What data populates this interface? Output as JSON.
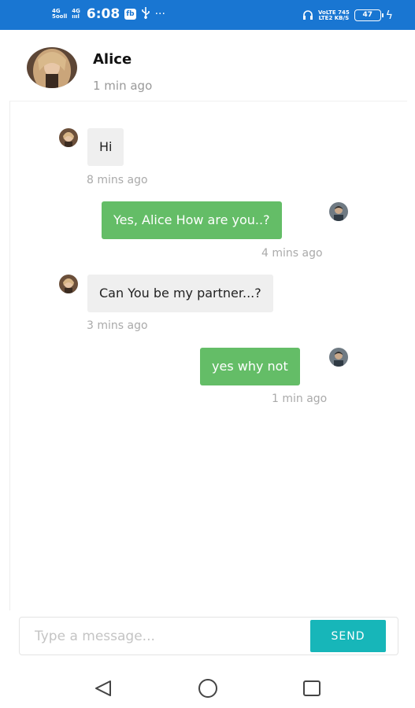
{
  "status_bar": {
    "net1_top": "4G",
    "net1_bottom": "5ooll",
    "net2_top": "4G",
    "net2_bottom": "ıııl",
    "time": "6:08",
    "app_badge": "fb",
    "usb_icon": "usb-icon",
    "more": "···",
    "headphone_icon": "headphone-icon",
    "speed_top": "VoLTE 745",
    "speed_bottom": "LTE2 KB/S",
    "battery": "47",
    "bolt": "ϟ",
    "color": "#1976d2"
  },
  "header": {
    "contact_name": "Alice",
    "contact_status": "1 min ago"
  },
  "messages": [
    {
      "direction": "in",
      "text": "Hi",
      "time": "8 mins ago"
    },
    {
      "direction": "out",
      "text": "Yes, Alice How are you..?",
      "time": "4 mins ago"
    },
    {
      "direction": "in",
      "text": "Can You be my partner...?",
      "time": "3 mins ago"
    },
    {
      "direction": "out",
      "text": "yes why not",
      "time": "1 min ago"
    }
  ],
  "composer": {
    "placeholder": "Type a message...",
    "value": "",
    "send_label": "SEND"
  },
  "navigation": {
    "back_icon": "back-triangle-icon",
    "home_icon": "home-circle-icon",
    "recents_icon": "recents-square-icon"
  },
  "colors": {
    "outgoing_bubble": "#64bd67",
    "incoming_bubble": "#efefef",
    "send_button": "#17b6b9"
  }
}
